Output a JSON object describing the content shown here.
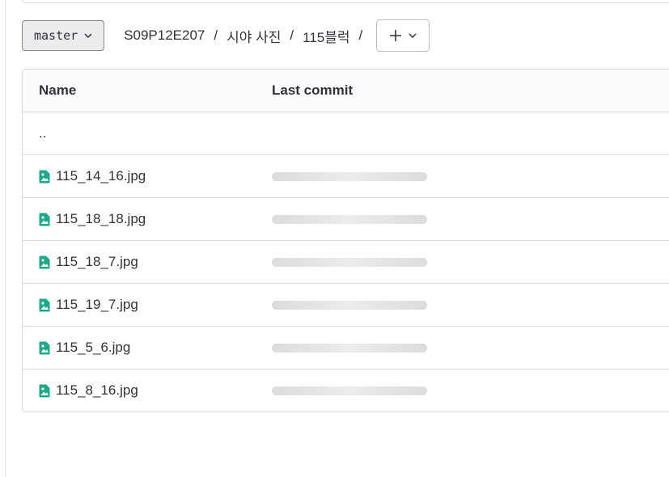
{
  "branch": {
    "label": "master"
  },
  "breadcrumb": {
    "items": [
      "S09P12E207",
      "시야 사진",
      "115블럭"
    ],
    "separator": "/"
  },
  "table": {
    "headers": {
      "name": "Name",
      "last_commit": "Last commit"
    },
    "parent_dir": "..",
    "files": [
      {
        "name": "115_14_16.jpg",
        "icon": "file-image-icon"
      },
      {
        "name": "115_18_18.jpg",
        "icon": "file-image-icon"
      },
      {
        "name": "115_18_7.jpg",
        "icon": "file-image-icon"
      },
      {
        "name": "115_19_7.jpg",
        "icon": "file-image-icon"
      },
      {
        "name": "115_5_6.jpg",
        "icon": "file-image-icon"
      },
      {
        "name": "115_8_16.jpg",
        "icon": "file-image-icon"
      }
    ]
  },
  "colors": {
    "icon_teal": "#1aaa8a",
    "border": "#dcdcde",
    "header_bg": "#fbfafd"
  }
}
